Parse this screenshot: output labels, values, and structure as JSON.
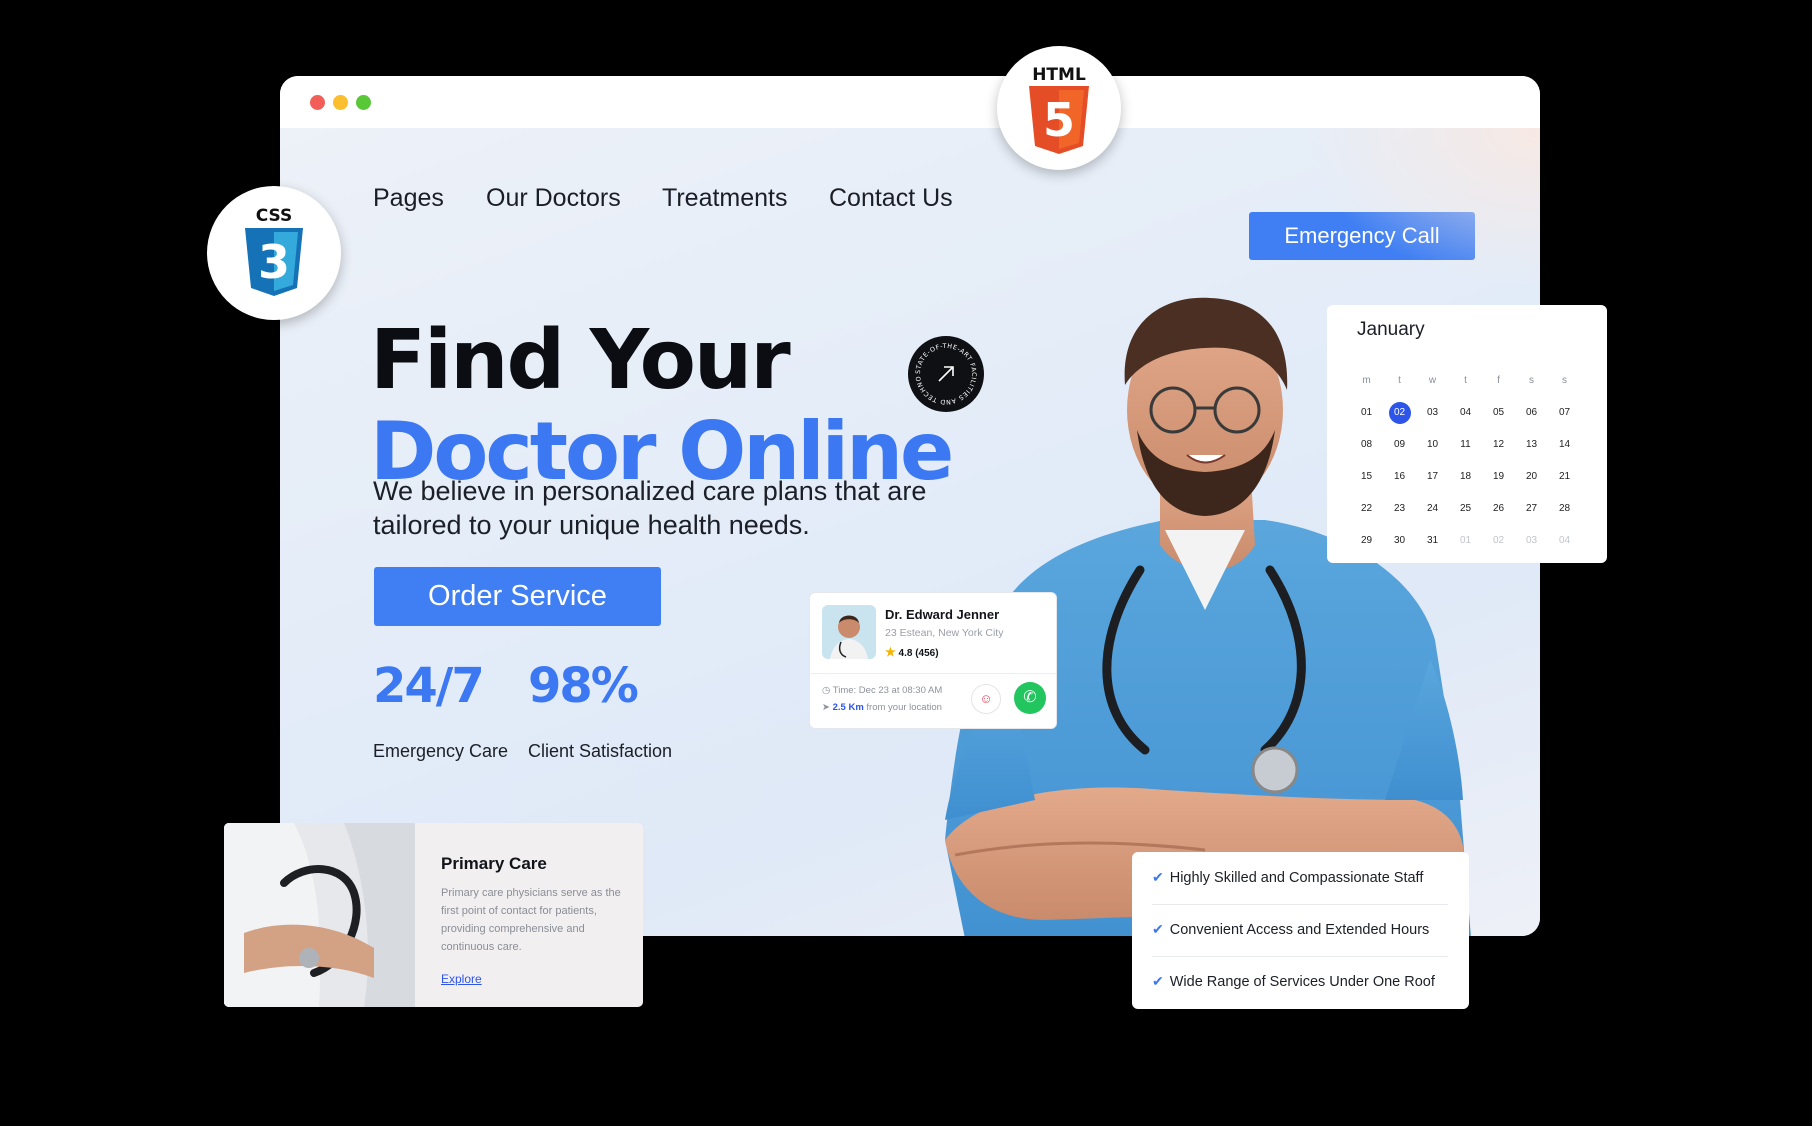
{
  "nav": {
    "items": [
      "Pages",
      "Our Doctors",
      "Treatments",
      "Contact Us"
    ],
    "emergency_button": "Emergency Call"
  },
  "hero": {
    "title_line1": "Find Your",
    "title_line2": "Doctor Online",
    "subtitle": "We believe in personalized care plans that are tailored to your unique health needs.",
    "order_button": "Order Service",
    "stats": [
      {
        "value": "24/7",
        "label": "Emergency Care"
      },
      {
        "value": "98%",
        "label": "Client Satisfaction"
      }
    ],
    "round_badge_text": "STATE-OF-THE-ART FACILITIES AND TECHNOLOGY"
  },
  "logos": {
    "html": "HTML",
    "html_digit": "5",
    "css": "CSS",
    "css_digit": "3"
  },
  "calendar": {
    "month": "January",
    "weekdays": [
      "m",
      "t",
      "w",
      "t",
      "f",
      "s",
      "s"
    ],
    "selected": "02",
    "weeks": [
      [
        "01",
        "02",
        "03",
        "04",
        "05",
        "06",
        "07"
      ],
      [
        "08",
        "09",
        "10",
        "11",
        "12",
        "13",
        "14"
      ],
      [
        "15",
        "16",
        "17",
        "18",
        "19",
        "20",
        "21"
      ],
      [
        "22",
        "23",
        "24",
        "25",
        "26",
        "27",
        "28"
      ],
      [
        "29",
        "30",
        "31",
        "01",
        "02",
        "03",
        "04"
      ]
    ],
    "next_month_days_count": 4
  },
  "doctor_card": {
    "name": "Dr. Edward Jenner",
    "address": "23 Estean, New York City",
    "rating": "4.8 (456)",
    "time": "Time: Dec 23 at 08:30 AM",
    "distance": "2.5 Km",
    "distance_suffix": "from your location"
  },
  "primary_care": {
    "title": "Primary Care",
    "text": "Primary care physicians serve as the first point of contact for patients, providing comprehensive and continuous care.",
    "link": "Explore"
  },
  "features": [
    "Highly Skilled and Compassionate Staff",
    "Convenient Access and Extended Hours",
    "Wide Range of Services Under One Roof"
  ],
  "colors": {
    "accent": "#3f7ff3",
    "dark": "#0c0d12",
    "calendar_selected": "#2d55e8",
    "call_green": "#22c55e"
  }
}
